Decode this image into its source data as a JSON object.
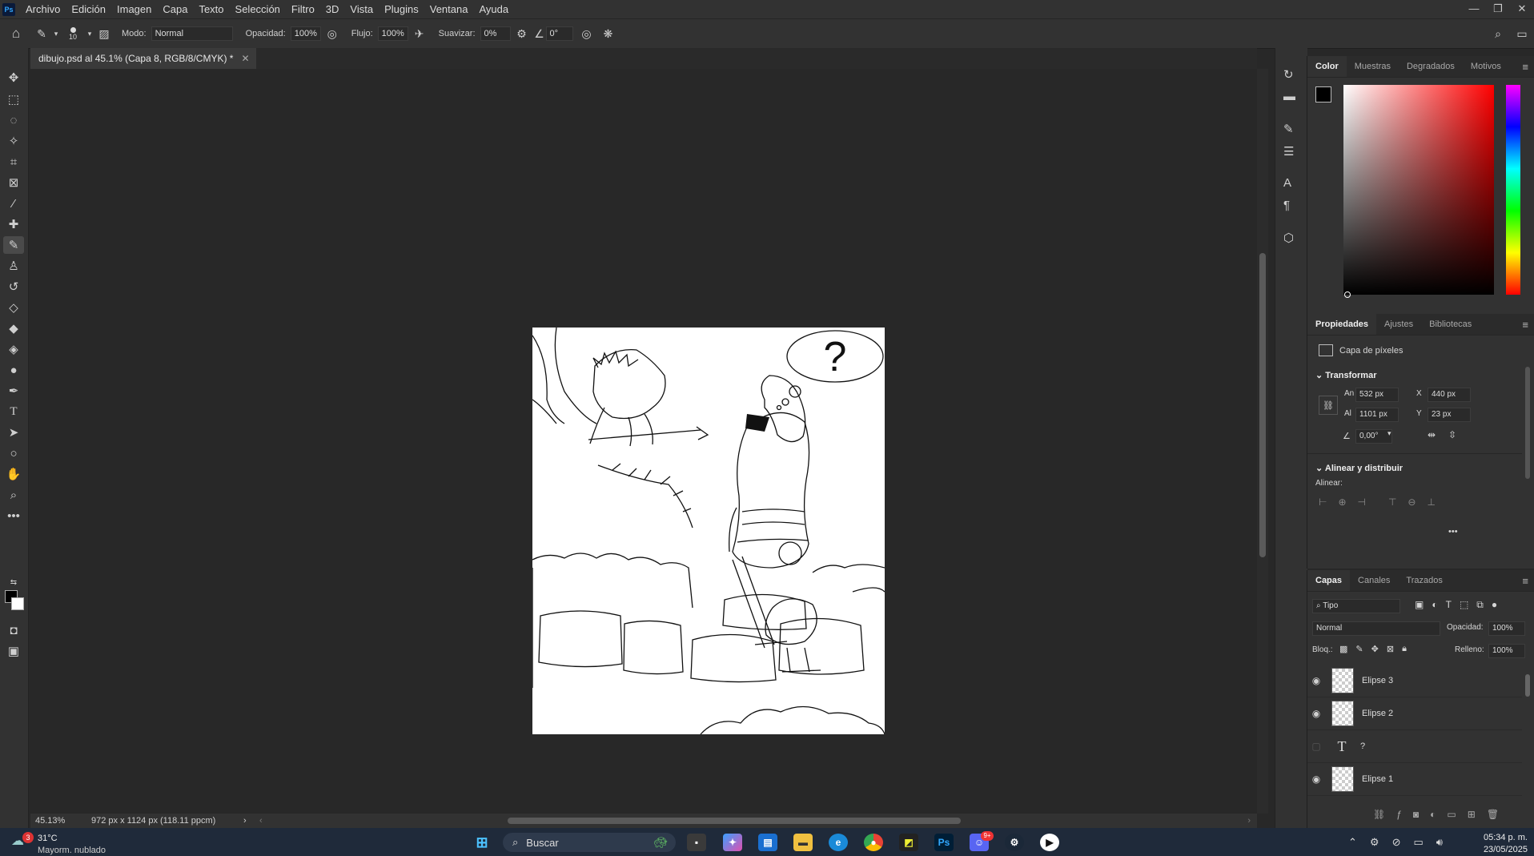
{
  "menu": {
    "app_icon": "Ps",
    "items": [
      "Archivo",
      "Edición",
      "Imagen",
      "Capa",
      "Texto",
      "Selección",
      "Filtro",
      "3D",
      "Vista",
      "Plugins",
      "Ventana",
      "Ayuda"
    ],
    "window_controls": [
      "—",
      "❐",
      "✕"
    ]
  },
  "options": {
    "brush_size": "10",
    "mode_label": "Modo:",
    "mode_value": "Normal",
    "opacity_label": "Opacidad:",
    "opacity_value": "100%",
    "flow_label": "Flujo:",
    "flow_value": "100%",
    "smooth_label": "Suavizar:",
    "smooth_value": "0%",
    "angle_value": "0°"
  },
  "document": {
    "tab_title": "dibujo.psd al 45.1% (Capa 8, RGB/8/CMYK) *",
    "zoom": "45.13%",
    "doc_info": "972 px x 1124 px (118.11 ppcm)",
    "thought_text": "?"
  },
  "color_panel": {
    "tabs": [
      "Color",
      "Muestras",
      "Degradados",
      "Motivos"
    ],
    "foreground": "#000000",
    "background": "#ffffff",
    "hue_base": "#ff0000"
  },
  "properties": {
    "tabs": [
      "Propiedades",
      "Ajustes",
      "Bibliotecas"
    ],
    "layer_type": "Capa de píxeles",
    "transform_title": "Transformar",
    "w_label": "An",
    "w_value": "532 px",
    "x_label": "X",
    "x_value": "440 px",
    "h_label": "Al",
    "h_value": "1101 px",
    "y_label": "Y",
    "y_value": "23 px",
    "angle_value": "0,00°",
    "align_title": "Alinear y distribuir",
    "align_label": "Alinear:",
    "more": "•••"
  },
  "layers": {
    "tabs": [
      "Capas",
      "Canales",
      "Trazados"
    ],
    "filter_value": "Tipo",
    "blend_value": "Normal",
    "opacity_label": "Opacidad:",
    "opacity_value": "100%",
    "lock_label": "Bloq.:",
    "fill_label": "Relleno:",
    "fill_value": "100%",
    "items": [
      {
        "name": "Elipse 3",
        "visible": true
      },
      {
        "name": "Elipse 2",
        "visible": true
      },
      {
        "name": "?",
        "visible": false,
        "type": "text"
      },
      {
        "name": "Elipse 1",
        "visible": true
      }
    ]
  },
  "taskbar": {
    "weather_badge": "3",
    "weather_temp": "31°C",
    "weather_desc": "Mayorm. nublado",
    "search_label": "Buscar",
    "time": "05:34 p. m.",
    "date": "23/05/2025",
    "discord_badge": "9+"
  }
}
